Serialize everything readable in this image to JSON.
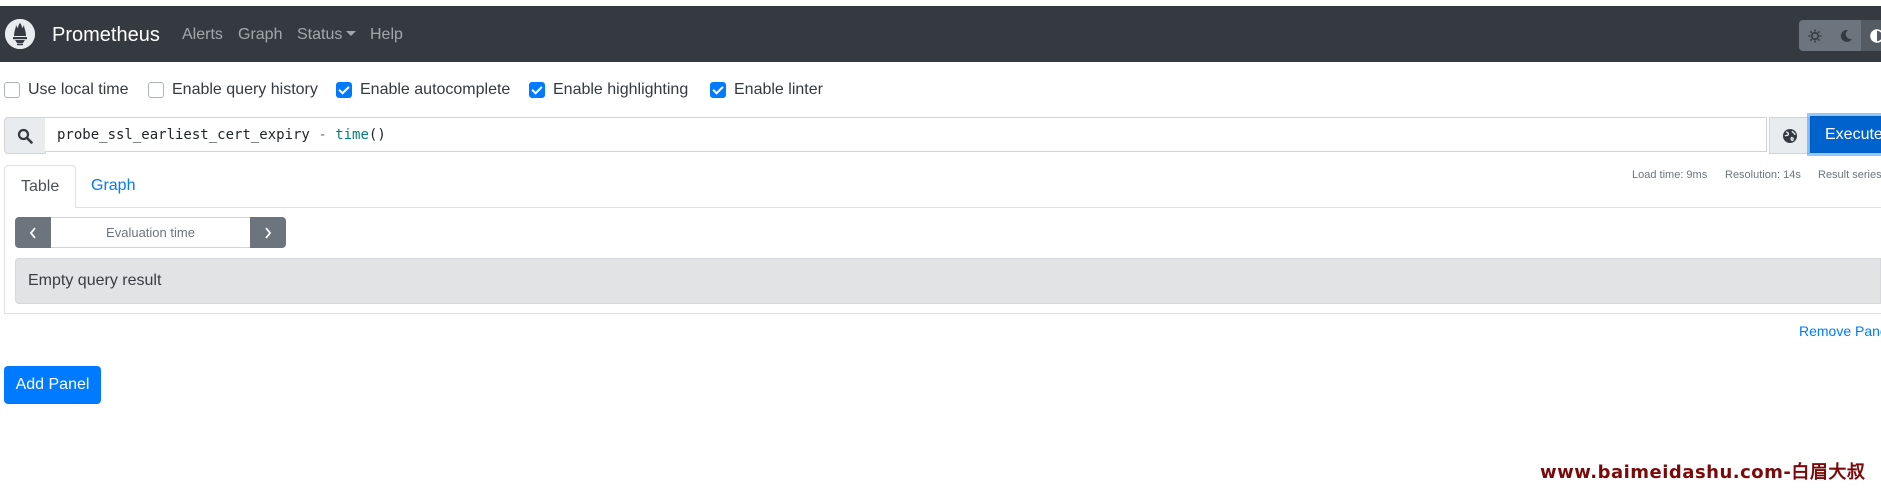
{
  "navbar": {
    "brand": "Prometheus",
    "links": [
      {
        "label": "Alerts"
      },
      {
        "label": "Graph"
      },
      {
        "label": "Status",
        "dropdown": true
      },
      {
        "label": "Help"
      }
    ],
    "theme_toggle": {
      "options": [
        "light-theme-icon",
        "dark-theme-icon",
        "auto-theme-icon"
      ],
      "selected": "auto-theme-icon"
    }
  },
  "options": [
    {
      "label": "Use local time",
      "checked": false
    },
    {
      "label": "Enable query history",
      "checked": false
    },
    {
      "label": "Enable autocomplete",
      "checked": true
    },
    {
      "label": "Enable highlighting",
      "checked": true
    },
    {
      "label": "Enable linter",
      "checked": true
    }
  ],
  "query": {
    "metric": "probe_ssl_earliest_cert_expiry",
    "operator": "-",
    "function": "time",
    "parens": "()",
    "execute_label": "Execute"
  },
  "panel": {
    "tabs": [
      {
        "label": "Table",
        "active": true
      },
      {
        "label": "Graph",
        "active": false
      }
    ],
    "stats": {
      "load_time": "Load time: 9ms",
      "resolution": "Resolution: 14s",
      "result_series": "Result series"
    },
    "eval_time_placeholder": "Evaluation time",
    "result_message": "Empty query result",
    "remove_label": "Remove Panel"
  },
  "add_panel_label": "Add Panel",
  "watermark": "www.baimeidashu.com-白眉大叔",
  "colors": {
    "navbar_bg": "#343a40",
    "primary": "#007bff",
    "execute_bg": "#0062cc",
    "secondary": "#6c757d",
    "alert_bg": "#e2e3e5",
    "function_token": "#008080",
    "watermark": "#7a0a0a"
  }
}
